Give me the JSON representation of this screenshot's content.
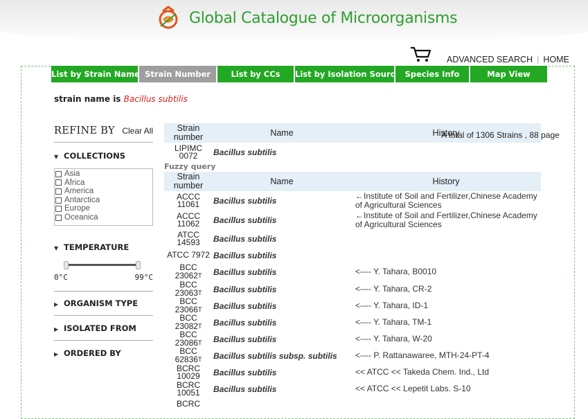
{
  "site": {
    "title": "Global Catalogue of Microorganisms"
  },
  "toplinks": {
    "advanced_search": "ADVANCED SEARCH",
    "separator": "|",
    "home": "HOME"
  },
  "tabs": [
    {
      "label": "List by Strain Name",
      "width": 125
    },
    {
      "label": "Strain Number",
      "width": 111,
      "active": true
    },
    {
      "label": "List by CCs",
      "width": 110
    },
    {
      "label": "List by Isolation Sources",
      "width": 143
    },
    {
      "label": "Species Info",
      "width": 106
    },
    {
      "label": "Map View",
      "width": 111
    }
  ],
  "filter": {
    "prefix": "strain name is",
    "term": "Bacillus subtilis"
  },
  "refine": {
    "title": "REFINE BY",
    "clear_all": "Clear All",
    "collections_label": "COLLECTIONS",
    "collections": [
      "Asia",
      "Africa",
      "America",
      "Antarctica",
      "Europe",
      "Oceanica"
    ],
    "temperature_label": "TEMPERATURE",
    "temp_min": "0°C",
    "temp_max": "99°C",
    "temp_range": [
      0,
      99
    ],
    "organism_type_label": "ORGANISM TYPE",
    "isolated_from_label": "ISOLATED FROM",
    "ordered_by_label": "ORDERED BY"
  },
  "results": {
    "total_text": "A total of 1306 Strains , 88 page",
    "headers": {
      "number": "Strain number",
      "name": "Name",
      "history": "History"
    },
    "exact": [
      {
        "number": "LIPIMC 0072",
        "name": "Bacillus subtilis",
        "history": ""
      }
    ],
    "fuzzy_label": "Fuzzy query",
    "fuzzy": [
      {
        "number": "ACCC 11061",
        "name": "Bacillus subtilis",
        "history": "←Institute of Soil and Fertilizer,Chinese Academy of Agricultural Sciences"
      },
      {
        "number": "ACCC 11062",
        "name": "Bacillus subtilis",
        "history": "←Institute of Soil and Fertilizer,Chinese Academy of Agricultural Sciences"
      },
      {
        "number": "ATCC 14593",
        "name": "Bacillus subtilis",
        "history": ""
      },
      {
        "number": "ATCC 7972",
        "name": "Bacillus subtilis",
        "history": ""
      },
      {
        "number": "BCC 23062",
        "sup": "T",
        "name": "Bacillus subtilis",
        "history": "<---- Y. Tahara, B0010"
      },
      {
        "number": "BCC 23063",
        "sup": "T",
        "name": "Bacillus subtilis",
        "history": "<---- Y. Tahara, CR-2"
      },
      {
        "number": "BCC 23066",
        "sup": "T",
        "name": "Bacillus subtilis",
        "history": "<---- Y. Tahara, ID-1"
      },
      {
        "number": "BCC 23082",
        "sup": "T",
        "name": "Bacillus subtilis",
        "history": "<---- Y. Tahara, TM-1"
      },
      {
        "number": "BCC 23086",
        "sup": "T",
        "name": "Bacillus subtilis",
        "history": "<---- Y. Tahara, W-20"
      },
      {
        "number": "BCC 62836",
        "sup": "T",
        "name": "Bacillus subtilis subsp. subtilis",
        "history": "<---- P. Rattanawaree, MTH-24-PT-4"
      },
      {
        "number": "BCRC 10029",
        "name": "Bacillus subtilis",
        "history": "<< ATCC << Takeda Chem. Ind., Ltd"
      },
      {
        "number": "BCRC 10051",
        "name": "Bacillus subtilis",
        "history": "<< ATCC << Lepetit Labs. S-10"
      },
      {
        "number": "BCRC",
        "name": "",
        "history": ""
      }
    ]
  },
  "colors": {
    "brand_green": "#2f9e2f",
    "tab_green": "#22a822",
    "tab_active": "#9e9e9e",
    "term_red": "#d62020",
    "table_header": "#e4eff7"
  }
}
